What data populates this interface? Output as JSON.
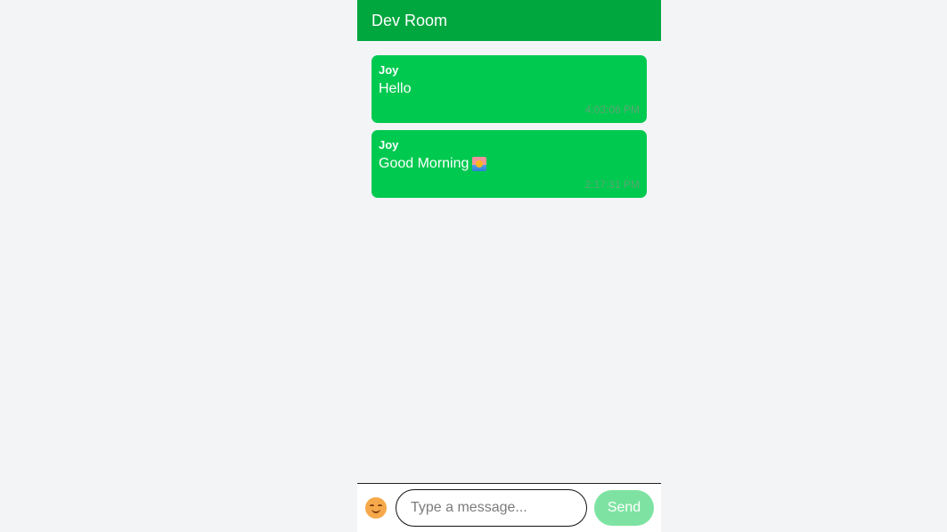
{
  "header": {
    "room_name": "Dev Room"
  },
  "messages": [
    {
      "sender": "Joy",
      "text": "Hello",
      "time": "4:03:06 PM",
      "emoji": ""
    },
    {
      "sender": "Joy",
      "text": "Good Morning",
      "time": "2:17:31 PM",
      "emoji": "sunrise-icon"
    }
  ],
  "composer": {
    "emoji_button": "smiling-face-icon",
    "placeholder": "Type a message...",
    "value": "",
    "send_label": "Send"
  },
  "colors": {
    "background": "#f3f4f6",
    "header_green": "#00a63e",
    "bubble_green": "#00c950",
    "send_disabled_green": "#7ee3a2"
  }
}
